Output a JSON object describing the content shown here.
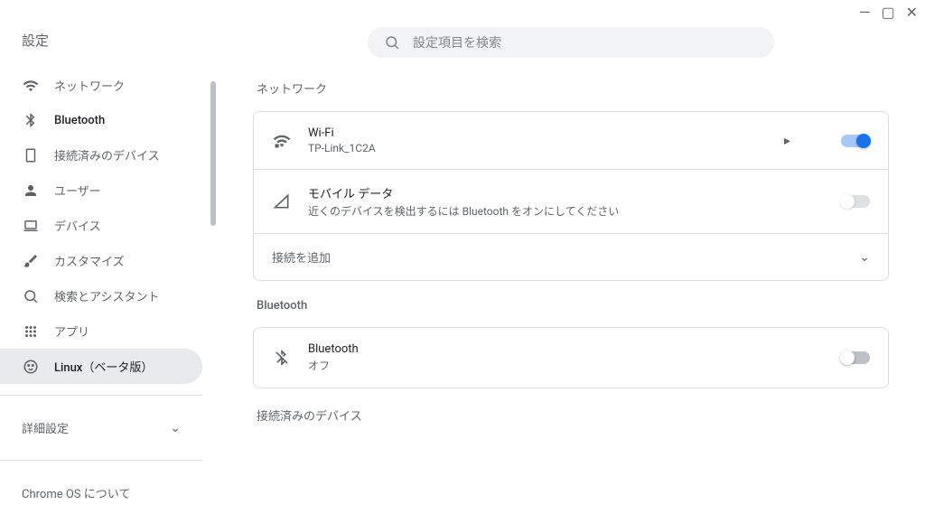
{
  "window": {
    "minimize": "—",
    "maximize": "▢",
    "close": "✕"
  },
  "sidebar": {
    "title": "設定",
    "items": [
      {
        "label": "ネットワーク"
      },
      {
        "label": "Bluetooth"
      },
      {
        "label": "接続済みのデバイス"
      },
      {
        "label": "ユーザー"
      },
      {
        "label": "デバイス"
      },
      {
        "label": "カスタマイズ"
      },
      {
        "label": "検索とアシスタント"
      },
      {
        "label": "アプリ"
      },
      {
        "label": "Linux（ベータ版）"
      }
    ],
    "advanced": "詳細設定",
    "about": "Chrome OS について"
  },
  "search": {
    "placeholder": "設定項目を検索"
  },
  "sections": {
    "network": {
      "title": "ネットワーク",
      "wifi": {
        "title": "Wi-Fi",
        "sub": "TP-Link_1C2A"
      },
      "mobile": {
        "title": "モバイル データ",
        "sub": "近くのデバイスを検出するには Bluetooth をオンにしてください"
      },
      "add": "接続を追加"
    },
    "bluetooth": {
      "title": "Bluetooth",
      "row": {
        "title": "Bluetooth",
        "sub": "オフ"
      }
    },
    "connected": {
      "title": "接続済みのデバイス"
    }
  }
}
